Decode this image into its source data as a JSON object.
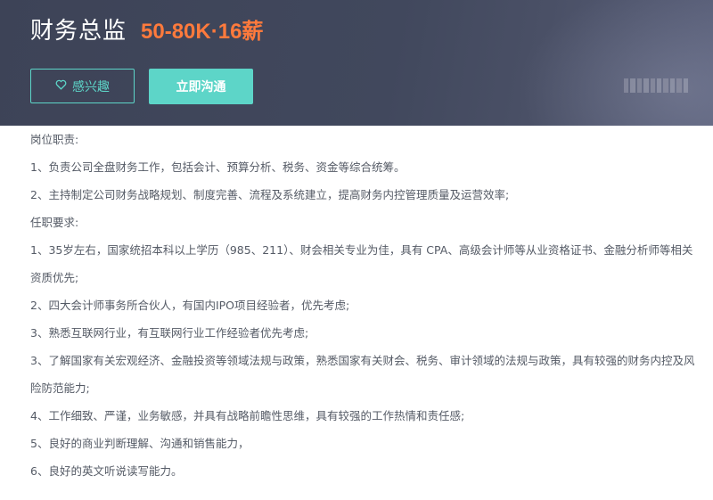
{
  "header": {
    "title": "财务总监",
    "salary": "50-80K·16薪",
    "interest_label": "感兴趣",
    "chat_label": "立即沟通"
  },
  "description": {
    "lines": [
      "岗位职责:",
      "1、负责公司全盘财务工作，包括会计、预算分析、税务、资金等综合统筹。",
      "2、主持制定公司财务战略规划、制度完善、流程及系统建立，提高财务内控管理质量及运营效率;",
      "任职要求:",
      "1、35岁左右，国家统招本科以上学历（985、211）、财会相关专业为佳，具有 CPA、高级会计师等从业资格证书、金融分析师等相关",
      "资质优先;",
      "2、四大会计师事务所合伙人，有国内IPO项目经验者，优先考虑;",
      "3、熟悉互联网行业，有互联网行业工作经验者优先考虑;",
      "3、了解国家有关宏观经济、金融投资等领域法规与政策，熟悉国家有关财会、税务、审计领域的法规与政策，具有较强的财务内控及风",
      "险防范能力;",
      "4、工作细致、严谨，业务敏感，并具有战略前瞻性思维，具有较强的工作热情和责任感;",
      "5、良好的商业判断理解、沟通和销售能力，",
      "6、良好的英文听说读写能力。"
    ]
  },
  "colors": {
    "header_bg": "#41485d",
    "salary": "#ff7a3c",
    "accent": "#5dd5c8",
    "body_text": "#555b66"
  },
  "icons": {
    "interest": "heart-outline-icon"
  }
}
